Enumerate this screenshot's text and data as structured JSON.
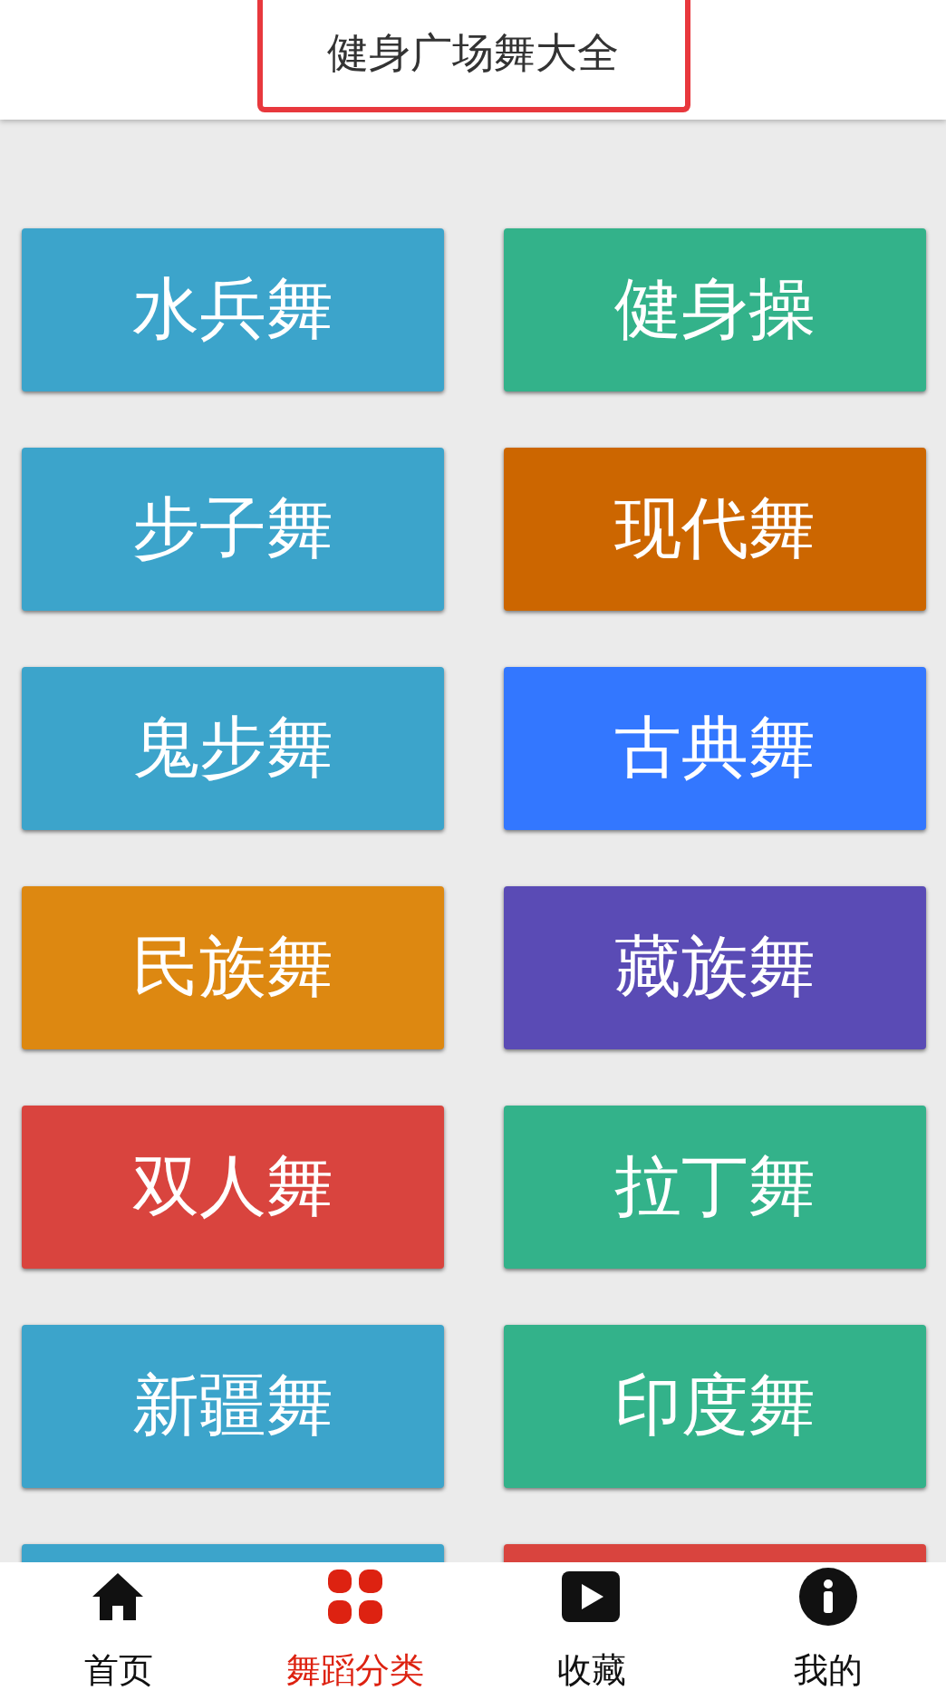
{
  "header": {
    "title": "健身广场舞大全"
  },
  "tiles": [
    {
      "label": "水兵舞",
      "color": "#3ca4cb"
    },
    {
      "label": "健身操",
      "color": "#33b28a"
    },
    {
      "label": "步子舞",
      "color": "#3ca4cb"
    },
    {
      "label": "现代舞",
      "color": "#cc6600"
    },
    {
      "label": "鬼步舞",
      "color": "#3ca4cb"
    },
    {
      "label": "古典舞",
      "color": "#3377ff"
    },
    {
      "label": "民族舞",
      "color": "#dd8811"
    },
    {
      "label": "藏族舞",
      "color": "#5a4bb5"
    },
    {
      "label": "双人舞",
      "color": "#d9443e"
    },
    {
      "label": "拉丁舞",
      "color": "#33b28a"
    },
    {
      "label": "新疆舞",
      "color": "#3ca4cb"
    },
    {
      "label": "印度舞",
      "color": "#33b28a"
    },
    {
      "color": "#3ca4cb"
    },
    {
      "color": "#d9443e"
    }
  ],
  "nav": [
    {
      "label": "首页",
      "selected": false
    },
    {
      "label": "舞蹈分类",
      "selected": true
    },
    {
      "label": "收藏",
      "selected": false
    },
    {
      "label": "我的",
      "selected": false
    }
  ]
}
